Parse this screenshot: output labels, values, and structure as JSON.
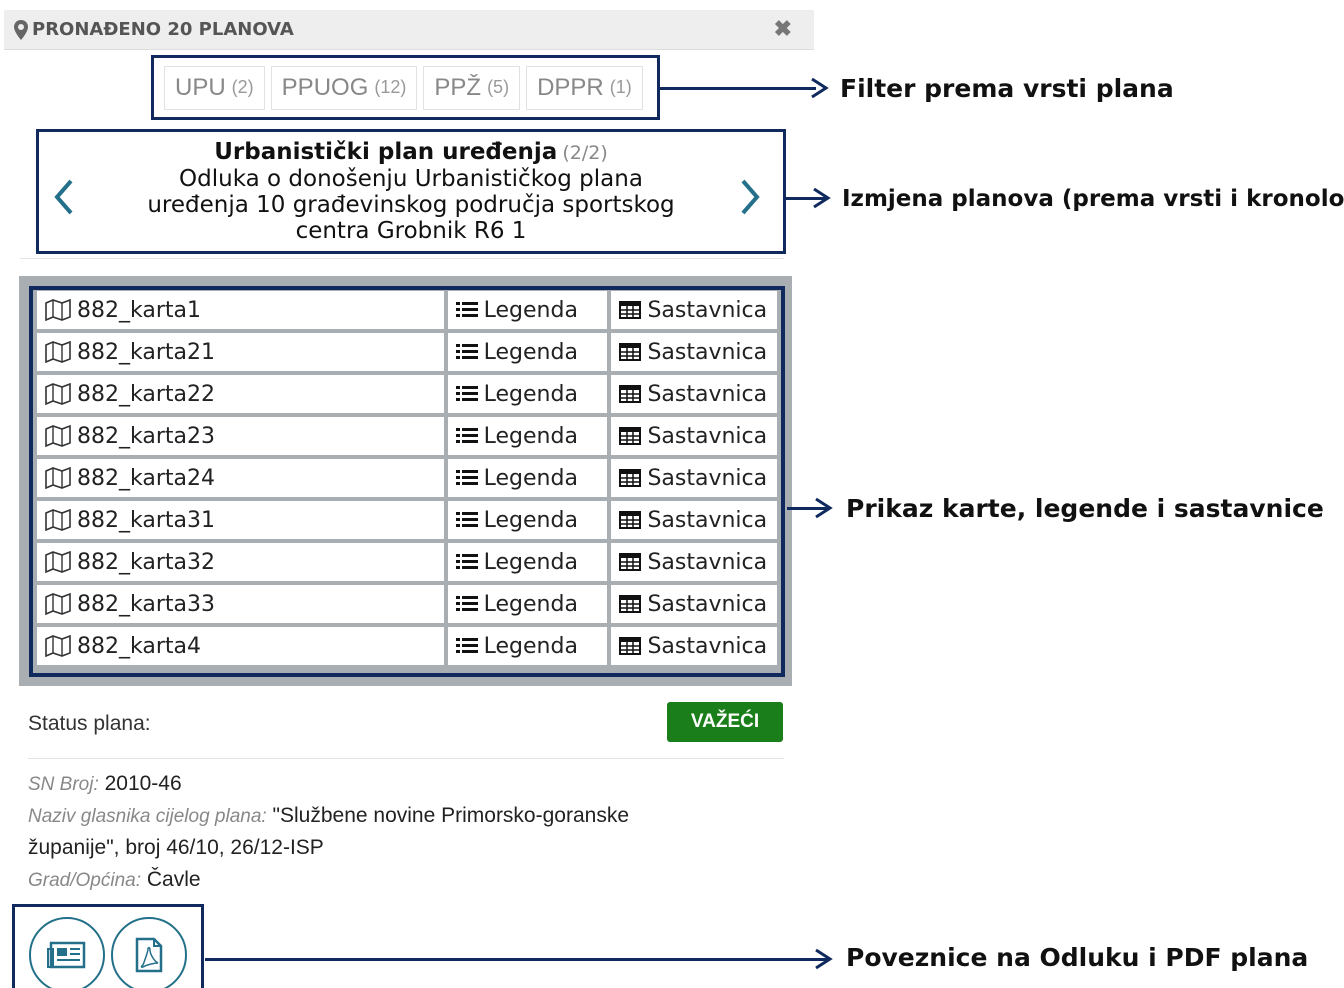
{
  "header": {
    "title": "PRONAĐENO 20 PLANOVA",
    "pin_icon": "map-marker-icon",
    "close_icon": "close-icon",
    "close_label": "✖"
  },
  "filters": [
    {
      "label": "UPU",
      "count": "(2)"
    },
    {
      "label": "PPUOG",
      "count": "(12)"
    },
    {
      "label": "PPŽ",
      "count": "(5)"
    },
    {
      "label": "DPPR",
      "count": "(1)"
    }
  ],
  "plan": {
    "title": "Urbanistički plan uređenja",
    "index": "(2/2)",
    "description_lines": [
      "Odluka o donošenju Urbanističkog plana",
      "uređenja 10 građevinskog područja sportskog",
      "centra Grobnik R6 1"
    ]
  },
  "maps": {
    "legend_label": "Legenda",
    "sastavnica_label": "Sastavnica",
    "rows": [
      "882_karta1",
      "882_karta21",
      "882_karta22",
      "882_karta23",
      "882_karta24",
      "882_karta31",
      "882_karta32",
      "882_karta33",
      "882_karta4"
    ]
  },
  "status": {
    "label": "Status plana:",
    "badge": "VAŽEĆI",
    "badge_color": "#1a7f1a"
  },
  "meta": {
    "sn_key": "SN Broj:",
    "sn_value": "2010-46",
    "glasnik_key": "Naziv glasnika cijelog plana:",
    "glasnik_value_1": "\"Službene novine Primorsko-goranske",
    "glasnik_value_2": "županije\", broj 46/10, 26/12-ISP",
    "grad_key": "Grad/Općina:",
    "grad_value": "Čavle"
  },
  "annotations": {
    "filter": "Filter prema vrsti plana",
    "izmjena": "Izmjena planova (prema vrsti i kronološki)",
    "prikaz": "Prikaz karte, legende i sastavnice",
    "poveznice": "Poveznice na Odluku i PDF plana"
  },
  "colors": {
    "annotation_border": "#102a5e",
    "accent": "#24708a"
  }
}
